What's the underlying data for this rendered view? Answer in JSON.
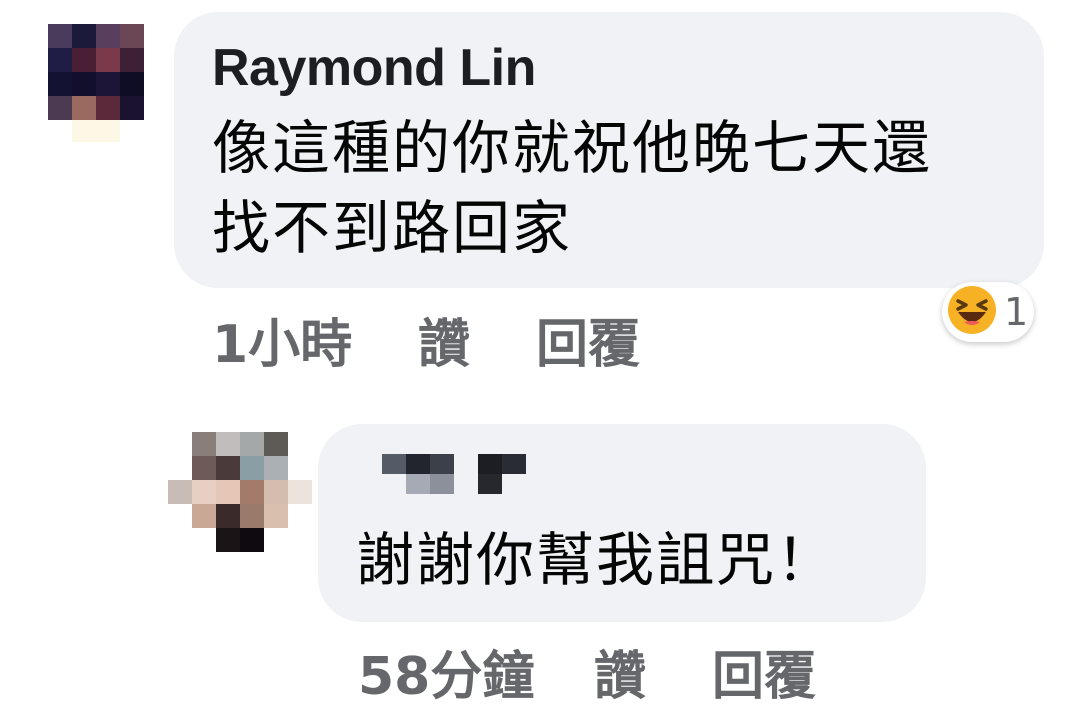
{
  "comments": [
    {
      "author": "Raymond Lin",
      "text": "像這種的你就祝他晚七天還\n找不到路回家",
      "time": "1小時",
      "like_label": "讚",
      "reply_label": "回覆",
      "reaction": {
        "icon": "laughing-emoji-icon",
        "count": "1"
      },
      "avatar_redacted": true
    },
    {
      "author_redacted": true,
      "text": "謝謝你幫我詛咒！",
      "time": "58分鐘",
      "like_label": "讚",
      "reply_label": "回覆",
      "avatar_redacted": true
    }
  ],
  "colors": {
    "bubble": "#f0f2f5",
    "meta_text": "#65676b",
    "body_text": "#050505",
    "reaction_face": "#f7b125"
  }
}
